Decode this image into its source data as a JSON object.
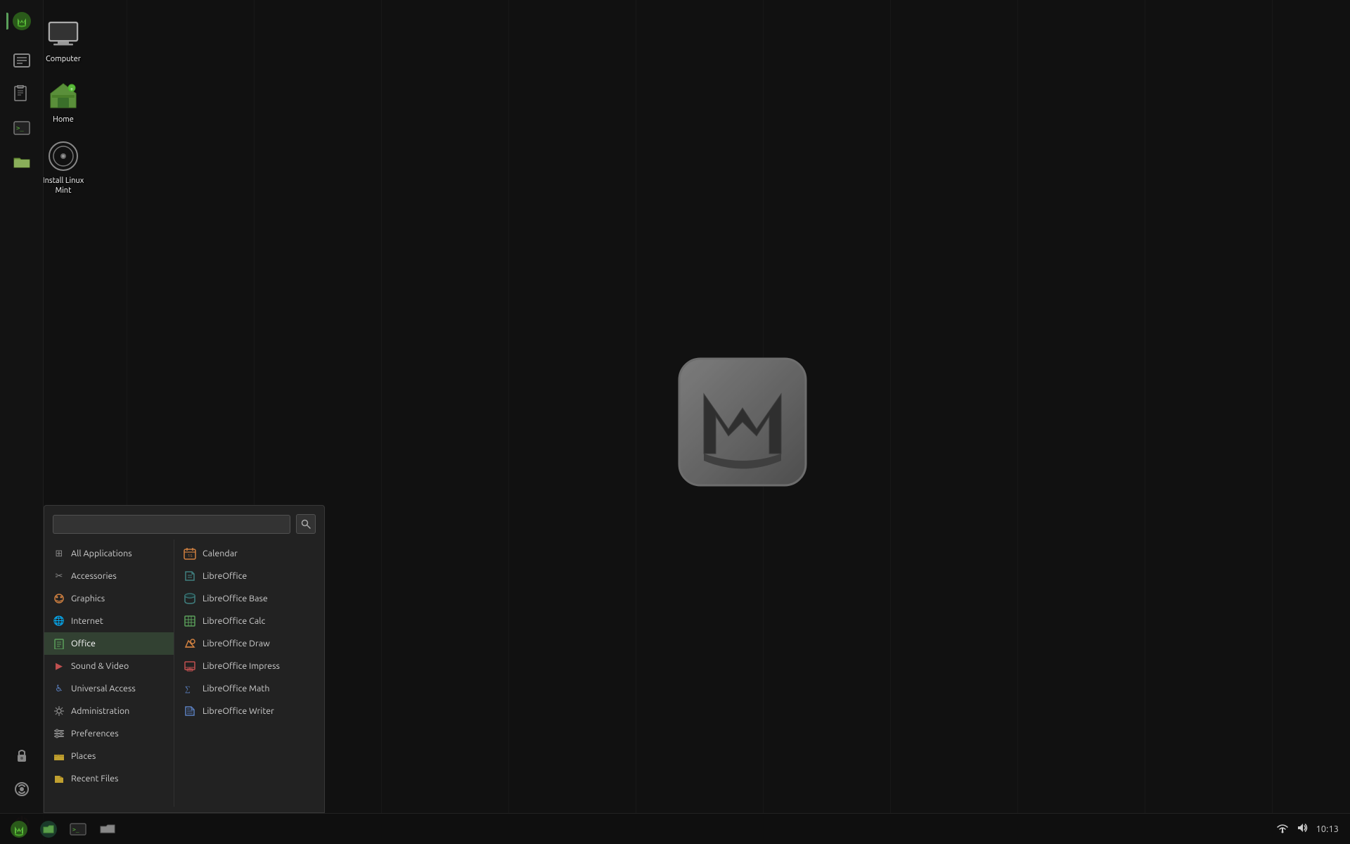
{
  "desktop": {
    "background_color": "#111111",
    "icons": [
      {
        "id": "computer",
        "label": "Computer",
        "icon_type": "monitor"
      },
      {
        "id": "home",
        "label": "Home",
        "icon_type": "folder-home"
      },
      {
        "id": "install-mint",
        "label": "Install Linux Mint",
        "icon_type": "disc"
      }
    ]
  },
  "taskbar_left": {
    "items": [
      {
        "id": "mintmenu",
        "icon": "🌿",
        "color": "#5a9f3a",
        "active": true
      },
      {
        "id": "files",
        "icon": "📋",
        "color": "#5a7fbf"
      },
      {
        "id": "terminal-app",
        "icon": "⬛",
        "color": "#333"
      },
      {
        "id": "terminal2",
        "icon": "▶",
        "color": "#555"
      },
      {
        "id": "folder-app",
        "icon": "📁",
        "color": "#7a9f4a"
      },
      {
        "id": "lock",
        "icon": "🔒",
        "color": "#888"
      },
      {
        "id": "update",
        "icon": "🔄",
        "color": "#888"
      },
      {
        "id": "power",
        "icon": "⏻",
        "color": "#c05050"
      }
    ]
  },
  "app_menu": {
    "search": {
      "placeholder": "",
      "value": ""
    },
    "categories": [
      {
        "id": "all-applications",
        "label": "All Applications",
        "icon": "⊞",
        "active": false
      },
      {
        "id": "accessories",
        "label": "Accessories",
        "icon": "✂",
        "color": "gray"
      },
      {
        "id": "graphics",
        "label": "Graphics",
        "icon": "🎨",
        "color": "orange"
      },
      {
        "id": "internet",
        "label": "Internet",
        "icon": "🌐",
        "color": "blue"
      },
      {
        "id": "office",
        "label": "Office",
        "icon": "📄",
        "color": "green",
        "active": true
      },
      {
        "id": "sound-video",
        "label": "Sound & Video",
        "icon": "▶",
        "color": "red"
      },
      {
        "id": "universal-access",
        "label": "Universal Access",
        "icon": "♿",
        "color": "blue"
      },
      {
        "id": "administration",
        "label": "Administration",
        "icon": "⚙",
        "color": "gray"
      },
      {
        "id": "preferences",
        "label": "Preferences",
        "icon": "☰",
        "color": "gray"
      },
      {
        "id": "places",
        "label": "Places",
        "icon": "📁",
        "color": "yellow"
      },
      {
        "id": "recent-files",
        "label": "Recent Files",
        "icon": "📂",
        "color": "yellow"
      }
    ],
    "apps": [
      {
        "id": "calendar",
        "label": "Calendar",
        "icon": "📅",
        "color": "orange"
      },
      {
        "id": "libreoffice",
        "label": "LibreOffice",
        "icon": "🦋",
        "color": "teal"
      },
      {
        "id": "libreoffice-base",
        "label": "LibreOffice Base",
        "icon": "🗃",
        "color": "teal"
      },
      {
        "id": "libreoffice-calc",
        "label": "LibreOffice Calc",
        "icon": "📊",
        "color": "green"
      },
      {
        "id": "libreoffice-draw",
        "label": "LibreOffice Draw",
        "icon": "✏",
        "color": "orange"
      },
      {
        "id": "libreoffice-impress",
        "label": "LibreOffice Impress",
        "icon": "📽",
        "color": "red"
      },
      {
        "id": "libreoffice-math",
        "label": "LibreOffice Math",
        "icon": "∑",
        "color": "blue"
      },
      {
        "id": "libreoffice-writer",
        "label": "LibreOffice Writer",
        "icon": "📝",
        "color": "blue"
      }
    ]
  },
  "taskbar_bottom": {
    "items": [
      {
        "id": "mint-start",
        "icon": "🌿",
        "color": "#5a9f3a"
      },
      {
        "id": "files-fm",
        "icon": "📁",
        "color": "#7a9f4a"
      },
      {
        "id": "terminal-bt",
        "icon": "▮",
        "color": "#333"
      },
      {
        "id": "folder-bt",
        "icon": "🗂",
        "color": "#888"
      }
    ],
    "system_tray": {
      "network_icon": "network",
      "volume_icon": "volume",
      "time": "10:13"
    }
  },
  "labels": {
    "all_applications": "All Applications",
    "accessories": "Accessories",
    "graphics": "Graphics",
    "internet": "Internet",
    "office": "Office",
    "sound_video": "Sound & Video",
    "universal_access": "Universal Access",
    "administration": "Administration",
    "preferences": "Preferences",
    "places": "Places",
    "recent_files": "Recent Files",
    "calendar": "Calendar",
    "libreoffice": "LibreOffice",
    "libreoffice_base": "LibreOffice Base",
    "libreoffice_calc": "LibreOffice Calc",
    "libreoffice_draw": "LibreOffice Draw",
    "libreoffice_impress": "LibreOffice Impress",
    "libreoffice_math": "LibreOffice Math",
    "libreoffice_writer": "LibreOffice Writer",
    "computer": "Computer",
    "home": "Home",
    "install_linux_mint": "Install Linux Mint",
    "time": "10:13"
  }
}
